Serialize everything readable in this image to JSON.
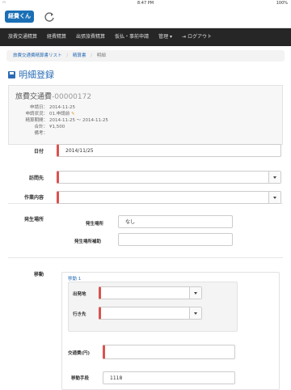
{
  "status": {
    "time": "8:47 PM",
    "battery": "100%"
  },
  "app": {
    "logo_text": "経費くん"
  },
  "nav": {
    "items": [
      "旅費交通精算",
      "経費精算",
      "出張旅費精算",
      "仮払・事前申請",
      "管理 ▾",
      "ログアウト"
    ]
  },
  "breadcrumb": {
    "items": [
      "旅費交通費精算書リスト",
      "精算書",
      "明細"
    ]
  },
  "page": {
    "title": "明細登録"
  },
  "summary": {
    "title": "旅費交通費",
    "number": "-00000172",
    "rows": [
      {
        "key": "申請日：",
        "value": "2014-11-25"
      },
      {
        "key": "申請状況：",
        "value": "01.申請前"
      },
      {
        "key": "精算期間：",
        "value": "2014-11-25 〜 2014-11-25"
      },
      {
        "key": "合計：",
        "value": "¥1,500"
      },
      {
        "key": "備考：",
        "value": ""
      }
    ]
  },
  "form": {
    "date_label": "日付",
    "date_value": "2014/11/25",
    "visit_label": "訪問先",
    "work_label": "作業内容",
    "place_label": "発生場所",
    "place_field_label": "発生場所",
    "place_field_value": "なし",
    "place_aux_label": "発生場所補助",
    "place_aux_value": "",
    "move_label": "移動",
    "move_group_label": "移動 1",
    "from_label": "出発地",
    "to_label": "行き先",
    "fare_label": "交通費(円)",
    "fare_value": "",
    "means_label": "移動手段",
    "means_value": "1118"
  }
}
